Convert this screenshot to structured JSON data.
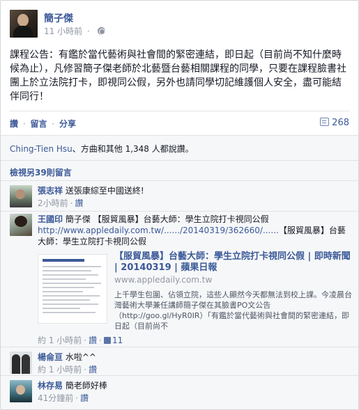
{
  "post": {
    "author": "簡子傑",
    "time": "11 小時前",
    "body": "課程公告：有鑑於當代藝術與社會間的緊密連結，即日起（目前尚不知什麼時候為止），凡修習簡子傑老師於北藝暨台藝相關課程的同學，只要在課程臉書社團上於立法院打卡，即視同公假，另外也請同學切記維護個人安全，盡可能結伴同行！",
    "icons": {
      "privacy": "globe-icon",
      "comments": "comment-icon",
      "like": "thumbs-up-icon"
    }
  },
  "actions": {
    "like": "讚",
    "comment": "留言",
    "share": "分享",
    "sep": "·",
    "comment_count": "268"
  },
  "likes": {
    "first": "Ching-Tien Hsu",
    "rest": "、方曲和其他 1,348 人都說讚。"
  },
  "view_more": "檢視另39則留言",
  "comments": [
    {
      "name": "張志祥",
      "text": "送張康綜至中國送終!",
      "time": "2小時前",
      "like": "讚"
    },
    {
      "name": "王國印",
      "text_pre": "簡子傑 【服貿風暴】台藝大師：學生立院打卡視同公假",
      "url": "http://www.appledaily.com.tw/....../20140319/362660/......",
      "text_post": "【服貿風暴】台藝大師：學生立院打卡視同公假",
      "preview_title": "【服貿風暴】台藝大師：學生立院打卡視同公假 | 即時新聞 | 20140319 | 蘋果日報",
      "preview_domain": "www.appledaily.com.tw",
      "preview_desc": "上千學生包圍、佔領立院，這些人顯然今天都無法到校上課。今凌晨台灣藝術大學兼任講師簡子傑在其臉書PO文公告（http://goo.gl/HyR0IR）「有鑑於當代藝術與社會間的緊密連結，即日起（目前尚不",
      "time": "約 1 小時前",
      "like": "讚",
      "likes": "11"
    },
    {
      "name": "楊侖亘",
      "text": "水啦^^",
      "time": "約 1 小時前",
      "like": "讚"
    },
    {
      "name": "林存易",
      "text": "簡老師好棒",
      "time": "41分鐘前",
      "like": "讚"
    }
  ]
}
